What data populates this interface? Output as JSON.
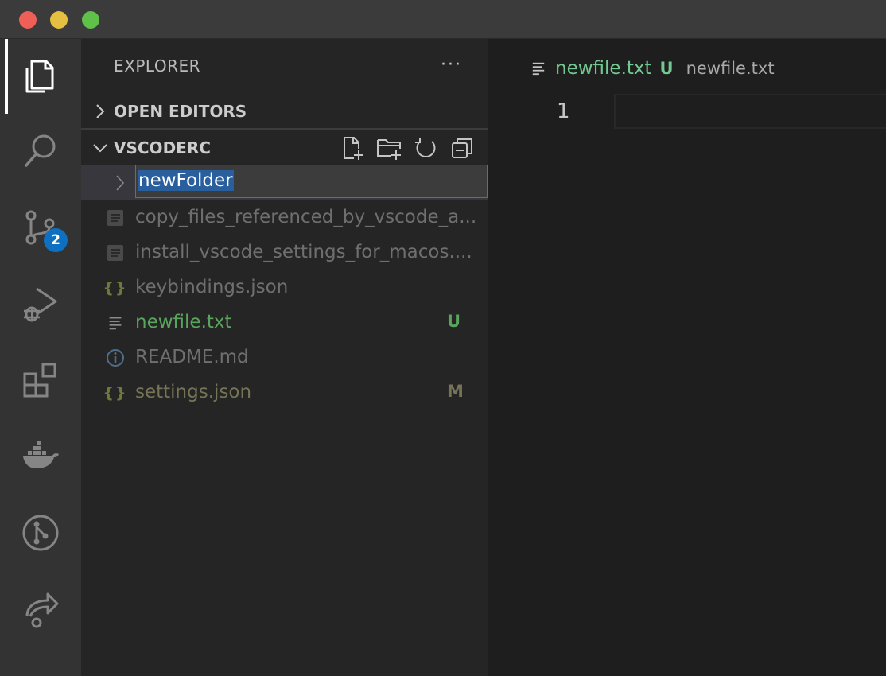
{
  "sidebar": {
    "title": "EXPLORER",
    "more_label": "···",
    "open_editors_label": "OPEN EDITORS",
    "workspace_label": "VSCODERC",
    "rename_value": "newFolder",
    "files": [
      {
        "name": "copy_files_referenced_by_vscode_a...",
        "status": "",
        "icon": "file-lines-icon"
      },
      {
        "name": "install_vscode_settings_for_macos....",
        "status": "",
        "icon": "file-lines-icon"
      },
      {
        "name": "keybindings.json",
        "status": "",
        "icon": "json-braces-icon"
      },
      {
        "name": "newfile.txt",
        "status": "U",
        "icon": "text-lines-icon"
      },
      {
        "name": "README.md",
        "status": "",
        "icon": "info-icon"
      },
      {
        "name": "settings.json",
        "status": "M",
        "icon": "json-braces-icon"
      }
    ]
  },
  "activity": {
    "source_control_badge": "2"
  },
  "editor": {
    "tab_name": "newfile.txt",
    "tab_status": "U",
    "breadcrumb": "newfile.txt",
    "line_number": "1"
  },
  "colors": {
    "untracked": "#73c991",
    "modified": "#767456",
    "accent": "#1b81d1",
    "badge": "#0e70c0"
  }
}
